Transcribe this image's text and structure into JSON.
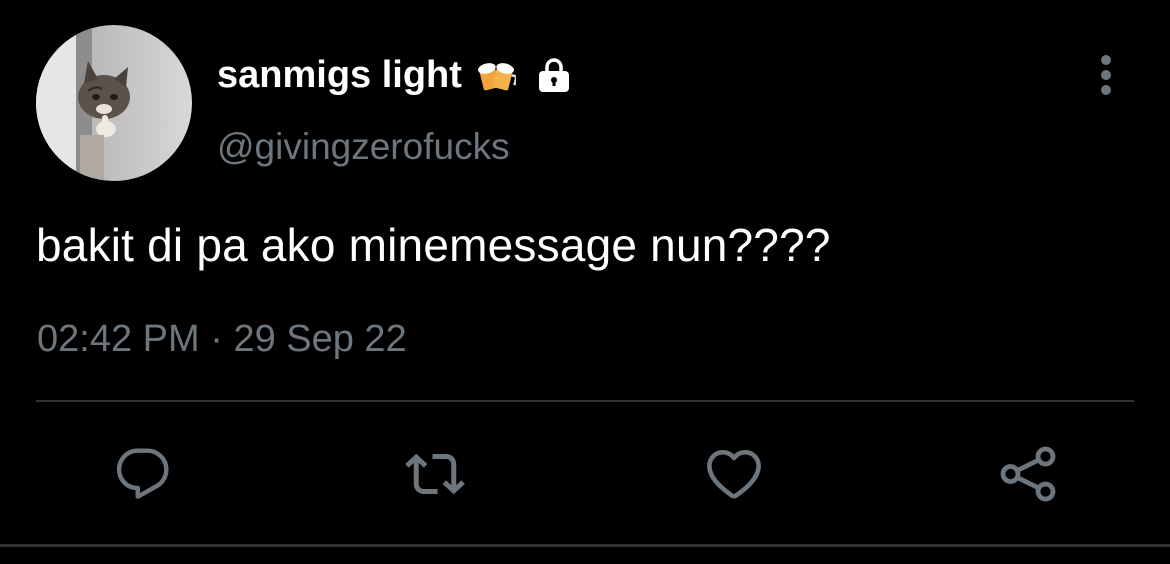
{
  "tweet": {
    "display_name": "sanmigs light",
    "name_emoji": "beer-mugs-icon",
    "protected_icon": "lock-icon",
    "handle": "@givingzerofucks",
    "text": "bakit di pa ako minemessage nun????",
    "time": "02:42 PM",
    "separator": "·",
    "date": "29 Sep 22"
  },
  "actions": [
    {
      "name": "reply",
      "icon": "reply-icon"
    },
    {
      "name": "retweet",
      "icon": "retweet-icon"
    },
    {
      "name": "like",
      "icon": "heart-icon"
    },
    {
      "name": "share",
      "icon": "share-icon"
    }
  ],
  "colors": {
    "background": "#000000",
    "primary_text": "#ffffff",
    "secondary_text": "#6e767d",
    "divider": "#2f3336",
    "icon": "#6e767d"
  }
}
